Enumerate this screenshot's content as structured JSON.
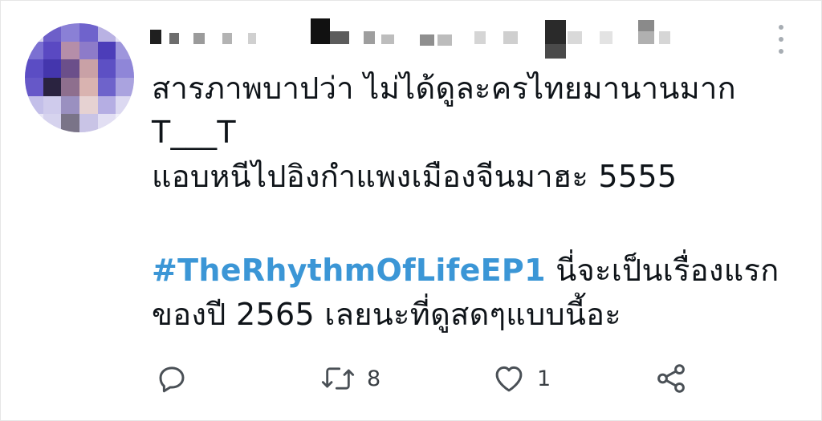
{
  "tweet": {
    "lines": [
      "สารภาพบาปว่า ไม่ได้ดูละครไทยมานานมาก",
      "T___T",
      "แอบหนีไปอิงกำแพงเมืองจีนมาฮะ 5555"
    ],
    "hashtag": "#TheRhythmOfLifeEP1",
    "after_hashtag": " นี่จะเป็นเรื่องแรก",
    "last_line": "ของปี 2565 เลยนะที่ดูสดๆแบบนี้อะ"
  },
  "actions": {
    "reply_icon": "reply-icon",
    "retweet_icon": "retweet-icon",
    "retweet_count": "8",
    "like_icon": "heart-icon",
    "like_count": "1",
    "share_icon": "share-icon"
  },
  "colors": {
    "hashtag": "#3b96d6",
    "icon": "#4a5056",
    "text": "#0f1419"
  }
}
